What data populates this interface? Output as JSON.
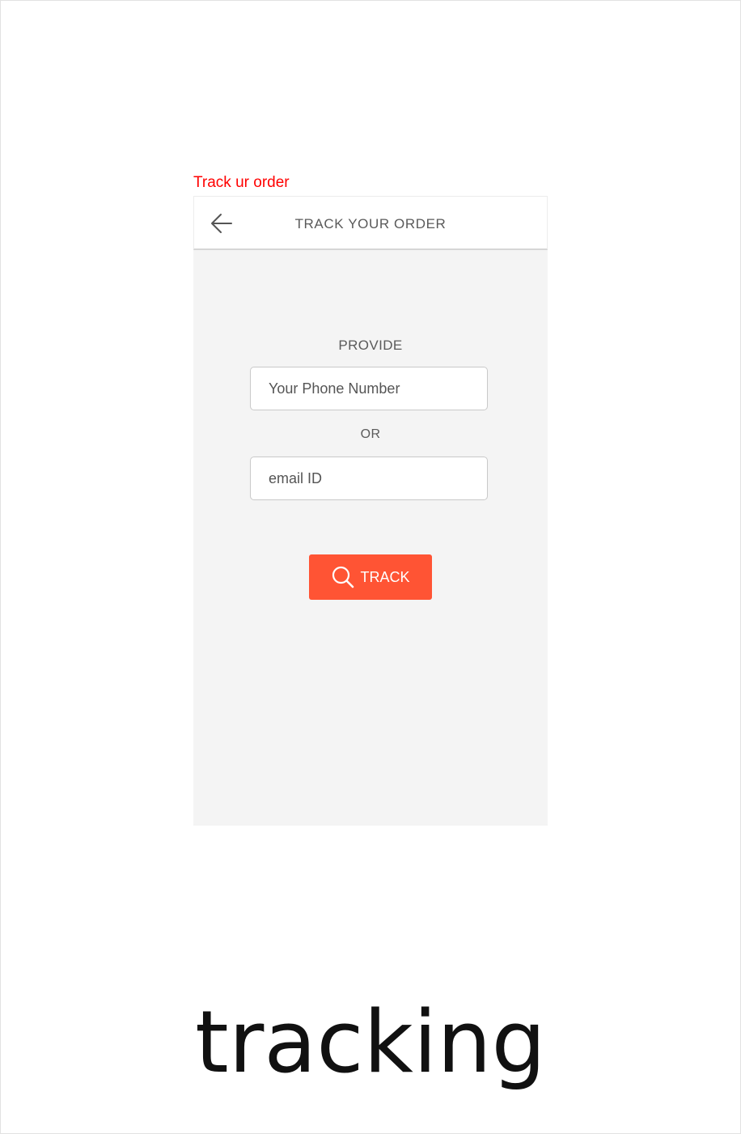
{
  "caption": "Track ur order",
  "appbar": {
    "back_icon": "arrow-left-icon",
    "title": "TRACK YOUR ORDER"
  },
  "form": {
    "provide_label": "PROVIDE",
    "phone_placeholder": "Your Phone Number",
    "or_label": "OR",
    "email_placeholder": "email ID",
    "track_button": {
      "label": "TRACK",
      "icon": "search-icon"
    }
  },
  "footer_label": "tracking",
  "colors": {
    "caption": "#ff0000",
    "accent": "#ff5434",
    "screen_bg": "#f4f4f4",
    "text": "#5a5a5a"
  }
}
